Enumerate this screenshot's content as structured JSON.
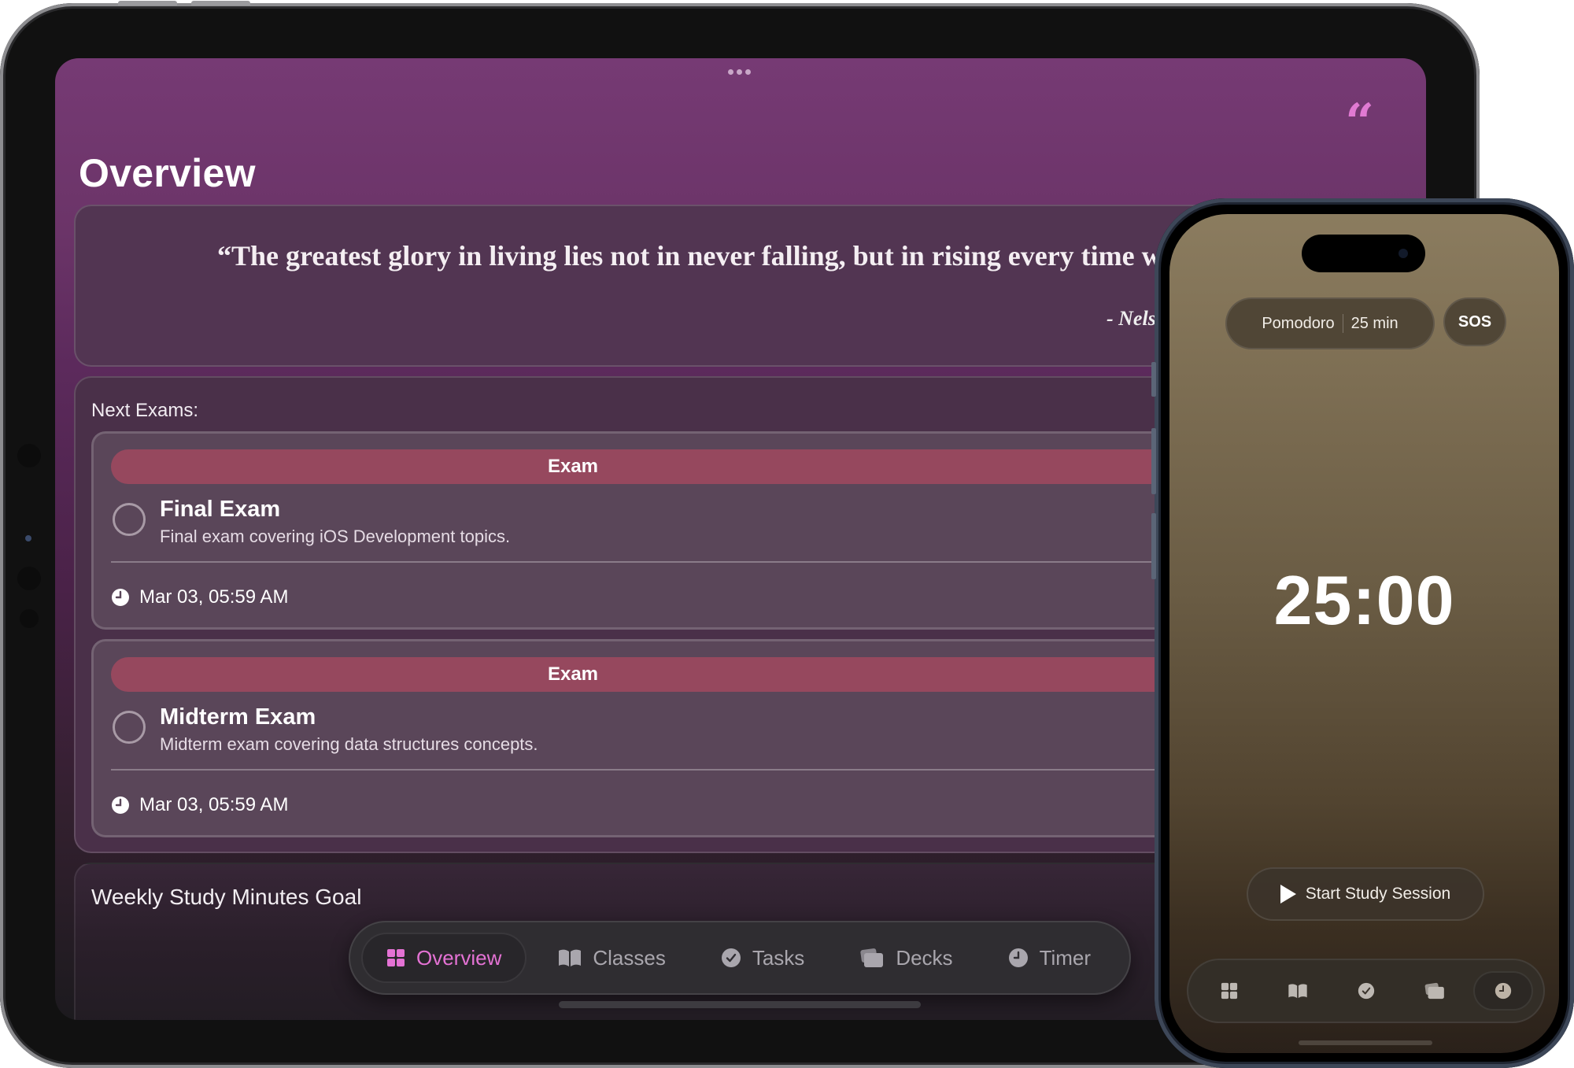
{
  "ipad": {
    "page_title": "Overview",
    "quote": {
      "text": "“The greatest glory in living lies not in never falling, but in rising every time we fall.”",
      "author": "- Nelson Mandela",
      "icon": "quote-icon"
    },
    "next_exams": {
      "label": "Next Exams:",
      "items": [
        {
          "tag": "Exam",
          "title": "Final Exam",
          "description": "Final exam covering iOS Development topics.",
          "datetime": "Mar 03, 05:59 AM",
          "completed": false
        },
        {
          "tag": "Exam",
          "title": "Midterm Exam",
          "description": "Midterm exam covering data structures concepts.",
          "datetime": "Mar 03, 05:59 AM",
          "completed": false
        }
      ]
    },
    "weekly_goal": {
      "title": "Weekly Study Minutes Goal"
    },
    "tabbar": {
      "active": "Overview",
      "tabs": [
        {
          "label": "Overview",
          "icon": "grid-icon"
        },
        {
          "label": "Classes",
          "icon": "book-icon"
        },
        {
          "label": "Tasks",
          "icon": "checkmark-circle-icon"
        },
        {
          "label": "Decks",
          "icon": "cards-icon"
        },
        {
          "label": "Timer",
          "icon": "clock-icon"
        }
      ]
    }
  },
  "iphone": {
    "mode": {
      "name": "Pomodoro",
      "duration": "25 min"
    },
    "sos_label": "SOS",
    "timer": "25:00",
    "start_button": "Start Study Session",
    "tabbar": {
      "active": "Timer",
      "tabs": [
        "grid-icon",
        "book-icon",
        "checkmark-circle-icon",
        "cards-icon",
        "clock-icon"
      ]
    }
  },
  "colors": {
    "accent_pink": "#e472d4",
    "exam_tag": "#96485e",
    "ipad_bg_top": "#763a74",
    "iphone_bg_top": "#8b7c5f",
    "tab_inactive": "#a9a6ad"
  }
}
